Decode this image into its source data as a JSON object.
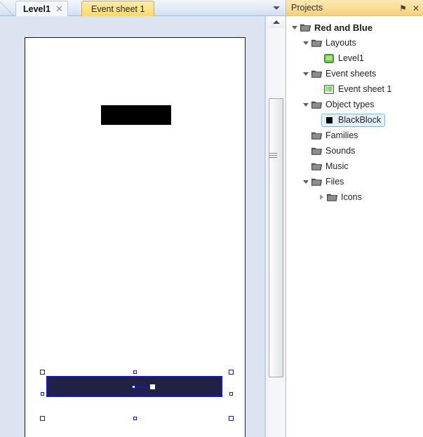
{
  "editor": {
    "tabs": [
      {
        "label": "Level1",
        "active": true,
        "closable": true,
        "close_glyph": "✕"
      },
      {
        "label": "Event sheet 1",
        "active": false,
        "closable": false
      }
    ],
    "tab_overflow_icon": "chevron-down-icon",
    "canvas": {
      "objects": [
        {
          "name": "BlackBlock",
          "color": "#000000",
          "selected": false
        },
        {
          "name": "BlueBar",
          "color": "#212145",
          "selected": true,
          "outline": "#1418c8"
        }
      ]
    },
    "scrollbar": {
      "up_arrow_icon": "triangle-up-icon",
      "orientation": "vertical"
    }
  },
  "projects": {
    "title": "Projects",
    "pin_label": "⚑",
    "close_label": "✕",
    "tree": [
      {
        "label": "Red and Blue",
        "icon": "folder-icon",
        "indent": 0,
        "state": "expanded",
        "bold": true
      },
      {
        "label": "Layouts",
        "icon": "folder-icon",
        "indent": 1,
        "state": "expanded",
        "bold": false
      },
      {
        "label": "Level1",
        "icon": "layout-icon",
        "indent": 2,
        "state": "leaf",
        "bold": false
      },
      {
        "label": "Event sheets",
        "icon": "folder-icon",
        "indent": 1,
        "state": "expanded",
        "bold": false
      },
      {
        "label": "Event sheet 1",
        "icon": "event-sheet-icon",
        "indent": 2,
        "state": "leaf",
        "bold": false
      },
      {
        "label": "Object types",
        "icon": "folder-icon",
        "indent": 1,
        "state": "expanded",
        "bold": false
      },
      {
        "label": "BlackBlock",
        "icon": "black-block-icon",
        "indent": 2,
        "state": "leaf",
        "bold": false,
        "selected": true
      },
      {
        "label": "Families",
        "icon": "folder-icon",
        "indent": 1,
        "state": "none",
        "bold": false
      },
      {
        "label": "Sounds",
        "icon": "folder-icon",
        "indent": 1,
        "state": "none",
        "bold": false
      },
      {
        "label": "Music",
        "icon": "folder-icon",
        "indent": 1,
        "state": "none",
        "bold": false
      },
      {
        "label": "Files",
        "icon": "folder-icon",
        "indent": 1,
        "state": "expanded",
        "bold": false
      },
      {
        "label": "Icons",
        "icon": "folder-icon",
        "indent": 2,
        "state": "collapsed",
        "bold": false
      }
    ]
  },
  "colors": {
    "tab_active_bg": "#f3f7fc",
    "tab_eventsheet_bg": "#fbd968",
    "panel_header_bg": "#f8dd96",
    "canvas_bg": "#dbe4f0",
    "selection_outline": "#1418c8",
    "selected_object_fill": "#212145",
    "black_object_fill": "#000000"
  }
}
